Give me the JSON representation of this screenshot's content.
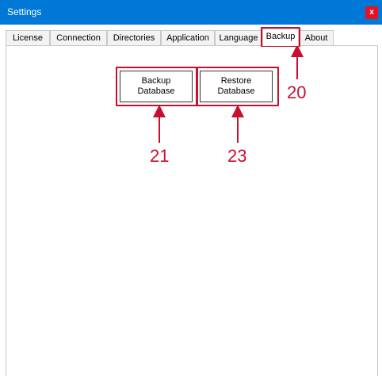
{
  "window": {
    "title": "Settings",
    "close_label": "x",
    "accent_color": "#0078d7",
    "close_color": "#e81123"
  },
  "tabs": [
    {
      "label": "License",
      "active": false
    },
    {
      "label": "Connection",
      "active": false
    },
    {
      "label": "Directories",
      "active": false
    },
    {
      "label": "Application",
      "active": false
    },
    {
      "label": "Language",
      "active": false
    },
    {
      "label": "Backup",
      "active": true
    },
    {
      "label": "About",
      "active": false
    }
  ],
  "backup": {
    "backup_button": {
      "line1": "Backup",
      "line2": "Database"
    },
    "restore_button": {
      "line1": "Restore",
      "line2": "Database"
    }
  },
  "annotations": {
    "color": "#c8102e",
    "callouts": [
      {
        "number": "20",
        "target": "Backup tab"
      },
      {
        "number": "21",
        "target": "Backup Database button"
      },
      {
        "number": "23",
        "target": "Restore Database button"
      }
    ]
  }
}
